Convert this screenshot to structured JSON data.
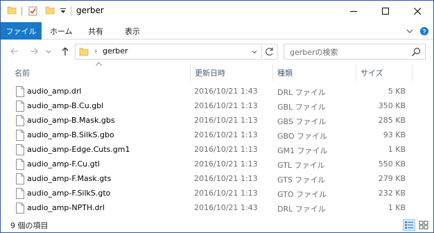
{
  "window": {
    "title": "gerber",
    "accent": "#1979ca"
  },
  "ribbon": {
    "tabs": [
      "ファイル",
      "ホーム",
      "共有",
      "表示"
    ]
  },
  "address": {
    "path": "gerber",
    "search_placeholder": "gerberの検索"
  },
  "columns": {
    "name": "名前",
    "date": "更新日時",
    "type": "種類",
    "size": "サイズ"
  },
  "files": [
    {
      "name": "audio_amp.drl",
      "date": "2016/10/21 1:43",
      "type": "DRL ファイル",
      "size": "5 KB"
    },
    {
      "name": "audio_amp-B.Cu.gbl",
      "date": "2016/10/21 1:13",
      "type": "GBL ファイル",
      "size": "350 KB"
    },
    {
      "name": "audio_amp-B.Mask.gbs",
      "date": "2016/10/21 1:13",
      "type": "GBS ファイル",
      "size": "285 KB"
    },
    {
      "name": "audio_amp-B.SilkS.gbo",
      "date": "2016/10/21 1:13",
      "type": "GBO ファイル",
      "size": "93 KB"
    },
    {
      "name": "audio_amp-Edge.Cuts.gm1",
      "date": "2016/10/21 1:13",
      "type": "GM1 ファイル",
      "size": "1 KB"
    },
    {
      "name": "audio_amp-F.Cu.gtl",
      "date": "2016/10/21 1:13",
      "type": "GTL ファイル",
      "size": "550 KB"
    },
    {
      "name": "audio_amp-F.Mask.gts",
      "date": "2016/10/21 1:13",
      "type": "GTS ファイル",
      "size": "279 KB"
    },
    {
      "name": "audio_amp-F.SilkS.gto",
      "date": "2016/10/21 1:13",
      "type": "GTO ファイル",
      "size": "232 KB"
    },
    {
      "name": "audio_amp-NPTH.drl",
      "date": "2016/10/21 1:43",
      "type": "DRL ファイル",
      "size": "1 KB"
    }
  ],
  "status": {
    "item_count": "9 個の項目"
  },
  "icons": {
    "quick_access": [
      "folder-icon",
      "checkmark-properties-icon",
      "new-folder-icon",
      "customize-dropdown-icon"
    ],
    "window_controls": [
      "minimize-icon",
      "maximize-icon",
      "close-icon"
    ],
    "navigation": [
      "back-arrow-icon",
      "forward-arrow-icon",
      "recent-locations-icon",
      "up-arrow-icon"
    ],
    "file": "document-icon"
  }
}
